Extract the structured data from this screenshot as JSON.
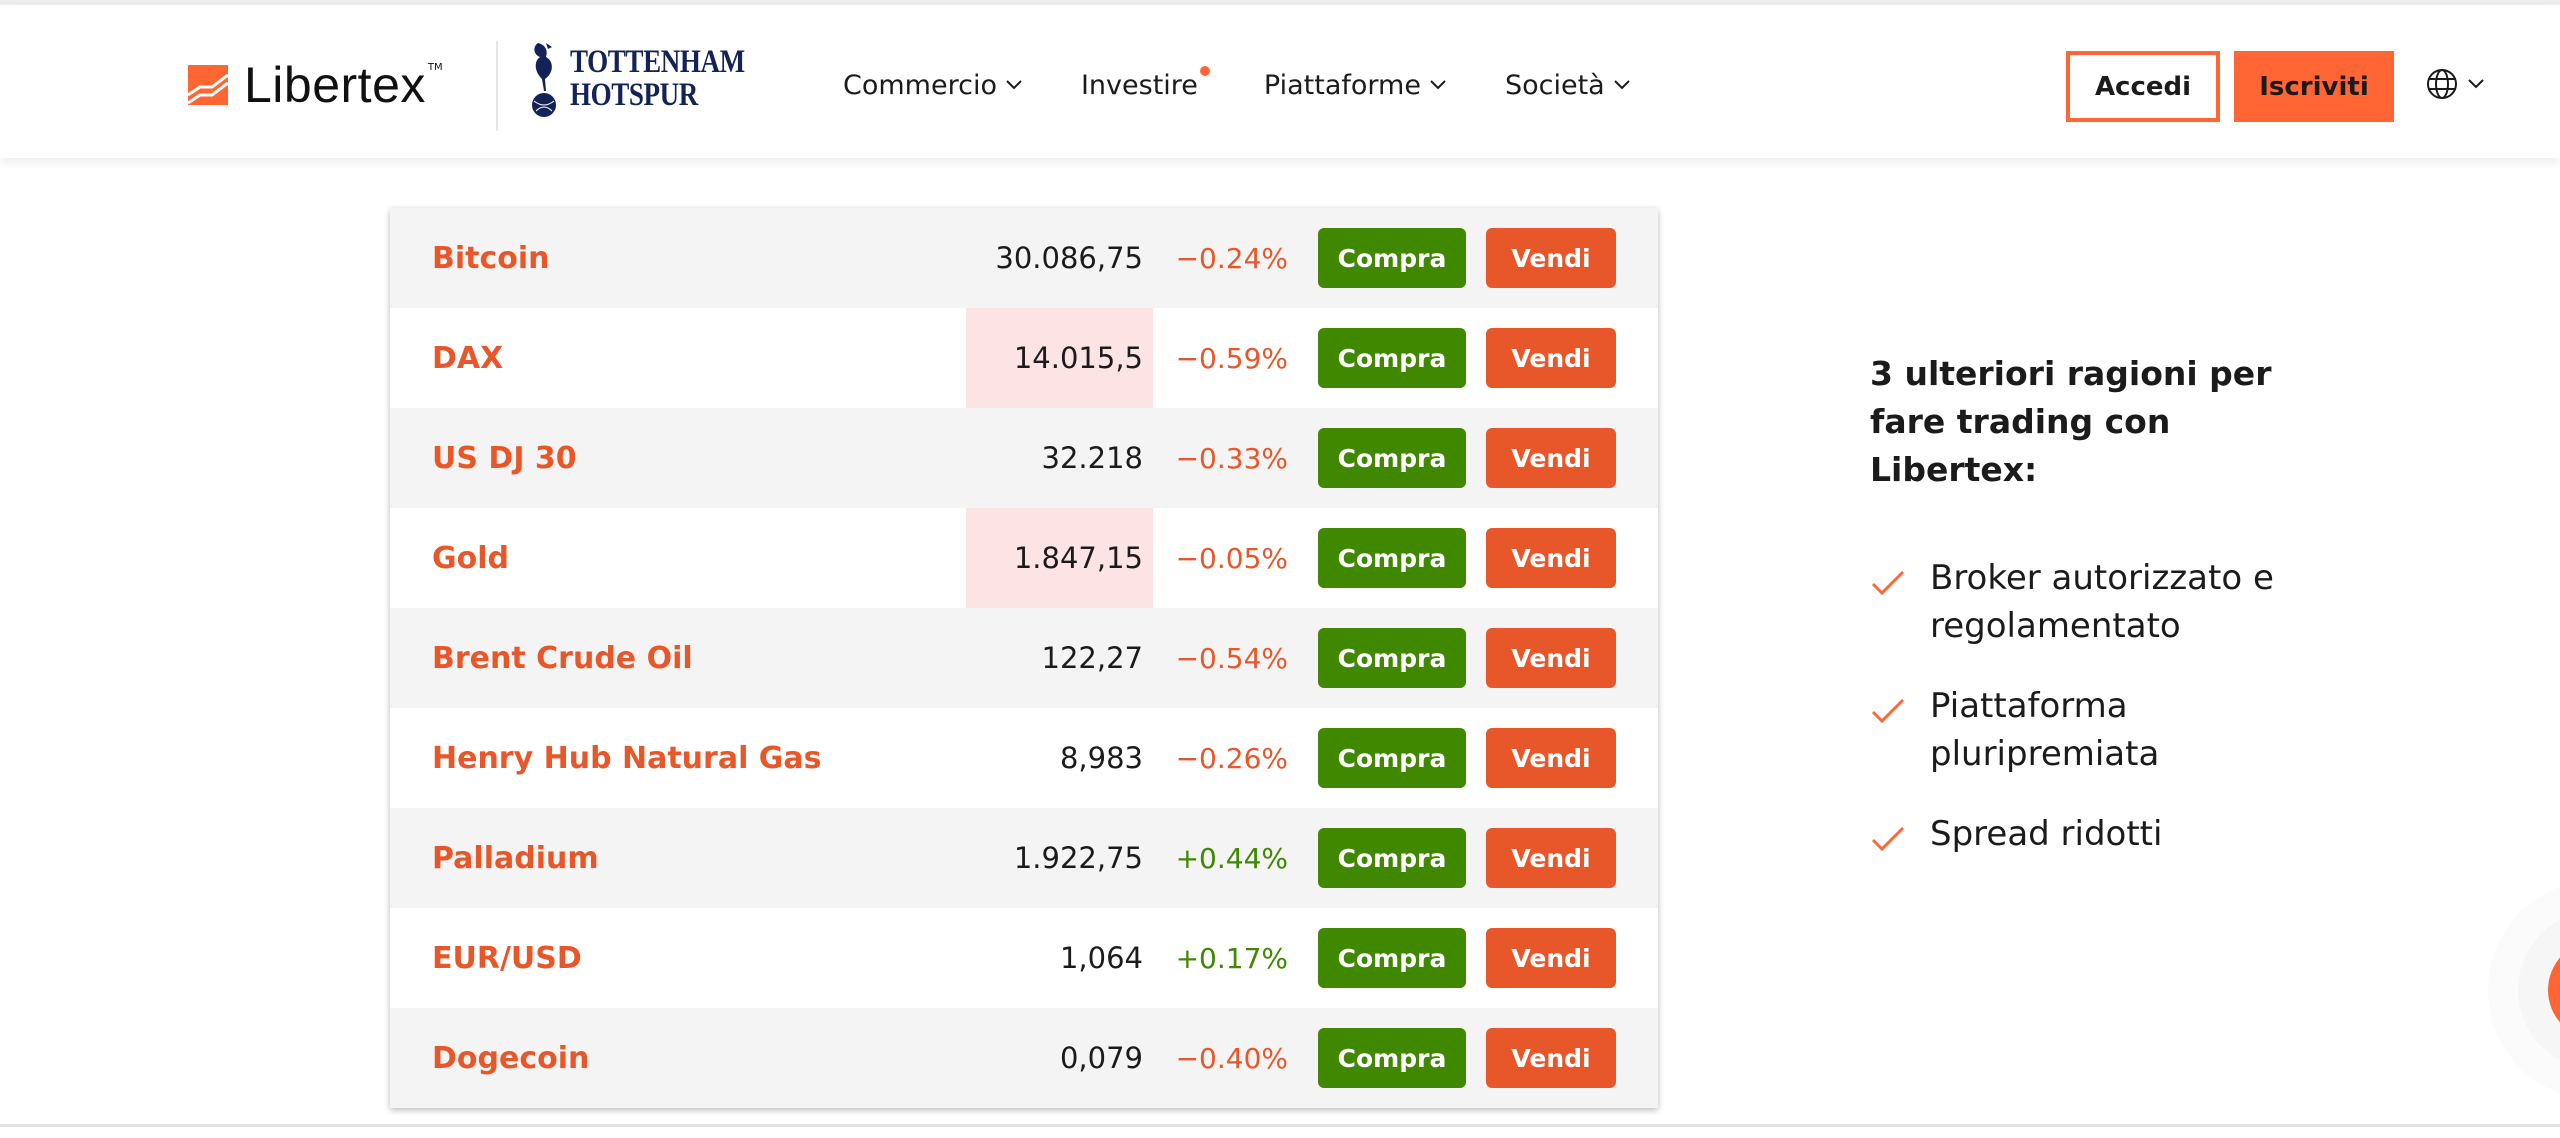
{
  "header": {
    "brand": {
      "name": "Libertex",
      "trademark": "TM",
      "icon": "libertex-logo-icon"
    },
    "partner": {
      "line1": "TOTTENHAM",
      "line2": "HOTSPUR",
      "icon": "tottenham-crest-icon"
    },
    "nav": [
      {
        "label": "Commercio",
        "has_dropdown": true,
        "badge": false
      },
      {
        "label": "Investire",
        "has_dropdown": false,
        "badge": true
      },
      {
        "label": "Piattaforme",
        "has_dropdown": true,
        "badge": false
      },
      {
        "label": "Società",
        "has_dropdown": true,
        "badge": false
      }
    ],
    "login_label": "Accedi",
    "signup_label": "Iscriviti",
    "language_icon": "globe-icon"
  },
  "colors": {
    "brand_orange": "#ff6633",
    "sell_orange": "#e8572a",
    "buy_green": "#3f8800",
    "negative": "#e8572a",
    "positive": "#3f8800",
    "price_flash": "#fce4e4",
    "tottenham_navy": "#132257"
  },
  "quotes": {
    "buy_label": "Compra",
    "sell_label": "Vendi",
    "rows": [
      {
        "name": "Bitcoin",
        "price": "30.086,75",
        "change": "−0.24%",
        "direction": "neg",
        "price_flash": false
      },
      {
        "name": "DAX",
        "price": "14.015,5",
        "change": "−0.59%",
        "direction": "neg",
        "price_flash": true
      },
      {
        "name": "US DJ 30",
        "price": "32.218",
        "change": "−0.33%",
        "direction": "neg",
        "price_flash": false
      },
      {
        "name": "Gold",
        "price": "1.847,15",
        "change": "−0.05%",
        "direction": "neg",
        "price_flash": true
      },
      {
        "name": "Brent Crude Oil",
        "price": "122,27",
        "change": "−0.54%",
        "direction": "neg",
        "price_flash": false
      },
      {
        "name": "Henry Hub Natural Gas",
        "price": "8,983",
        "change": "−0.26%",
        "direction": "neg",
        "price_flash": false
      },
      {
        "name": "Palladium",
        "price": "1.922,75",
        "change": "+0.44%",
        "direction": "pos",
        "price_flash": false
      },
      {
        "name": "EUR/USD",
        "price": "1,064",
        "change": "+0.17%",
        "direction": "pos",
        "price_flash": false
      },
      {
        "name": "Dogecoin",
        "price": "0,079",
        "change": "−0.40%",
        "direction": "neg",
        "price_flash": false
      }
    ]
  },
  "reasons": {
    "title": "3 ulteriori ragioni per fare trading con Libertex:",
    "items": [
      {
        "text": "Broker autorizzato e regolamentato",
        "icon": "check-icon"
      },
      {
        "text": "Piattaforma pluripremiata",
        "icon": "check-icon"
      },
      {
        "text": "Spread ridotti",
        "icon": "check-icon"
      }
    ]
  },
  "chat_widget": {
    "icon": "chat-bubble-icon"
  }
}
